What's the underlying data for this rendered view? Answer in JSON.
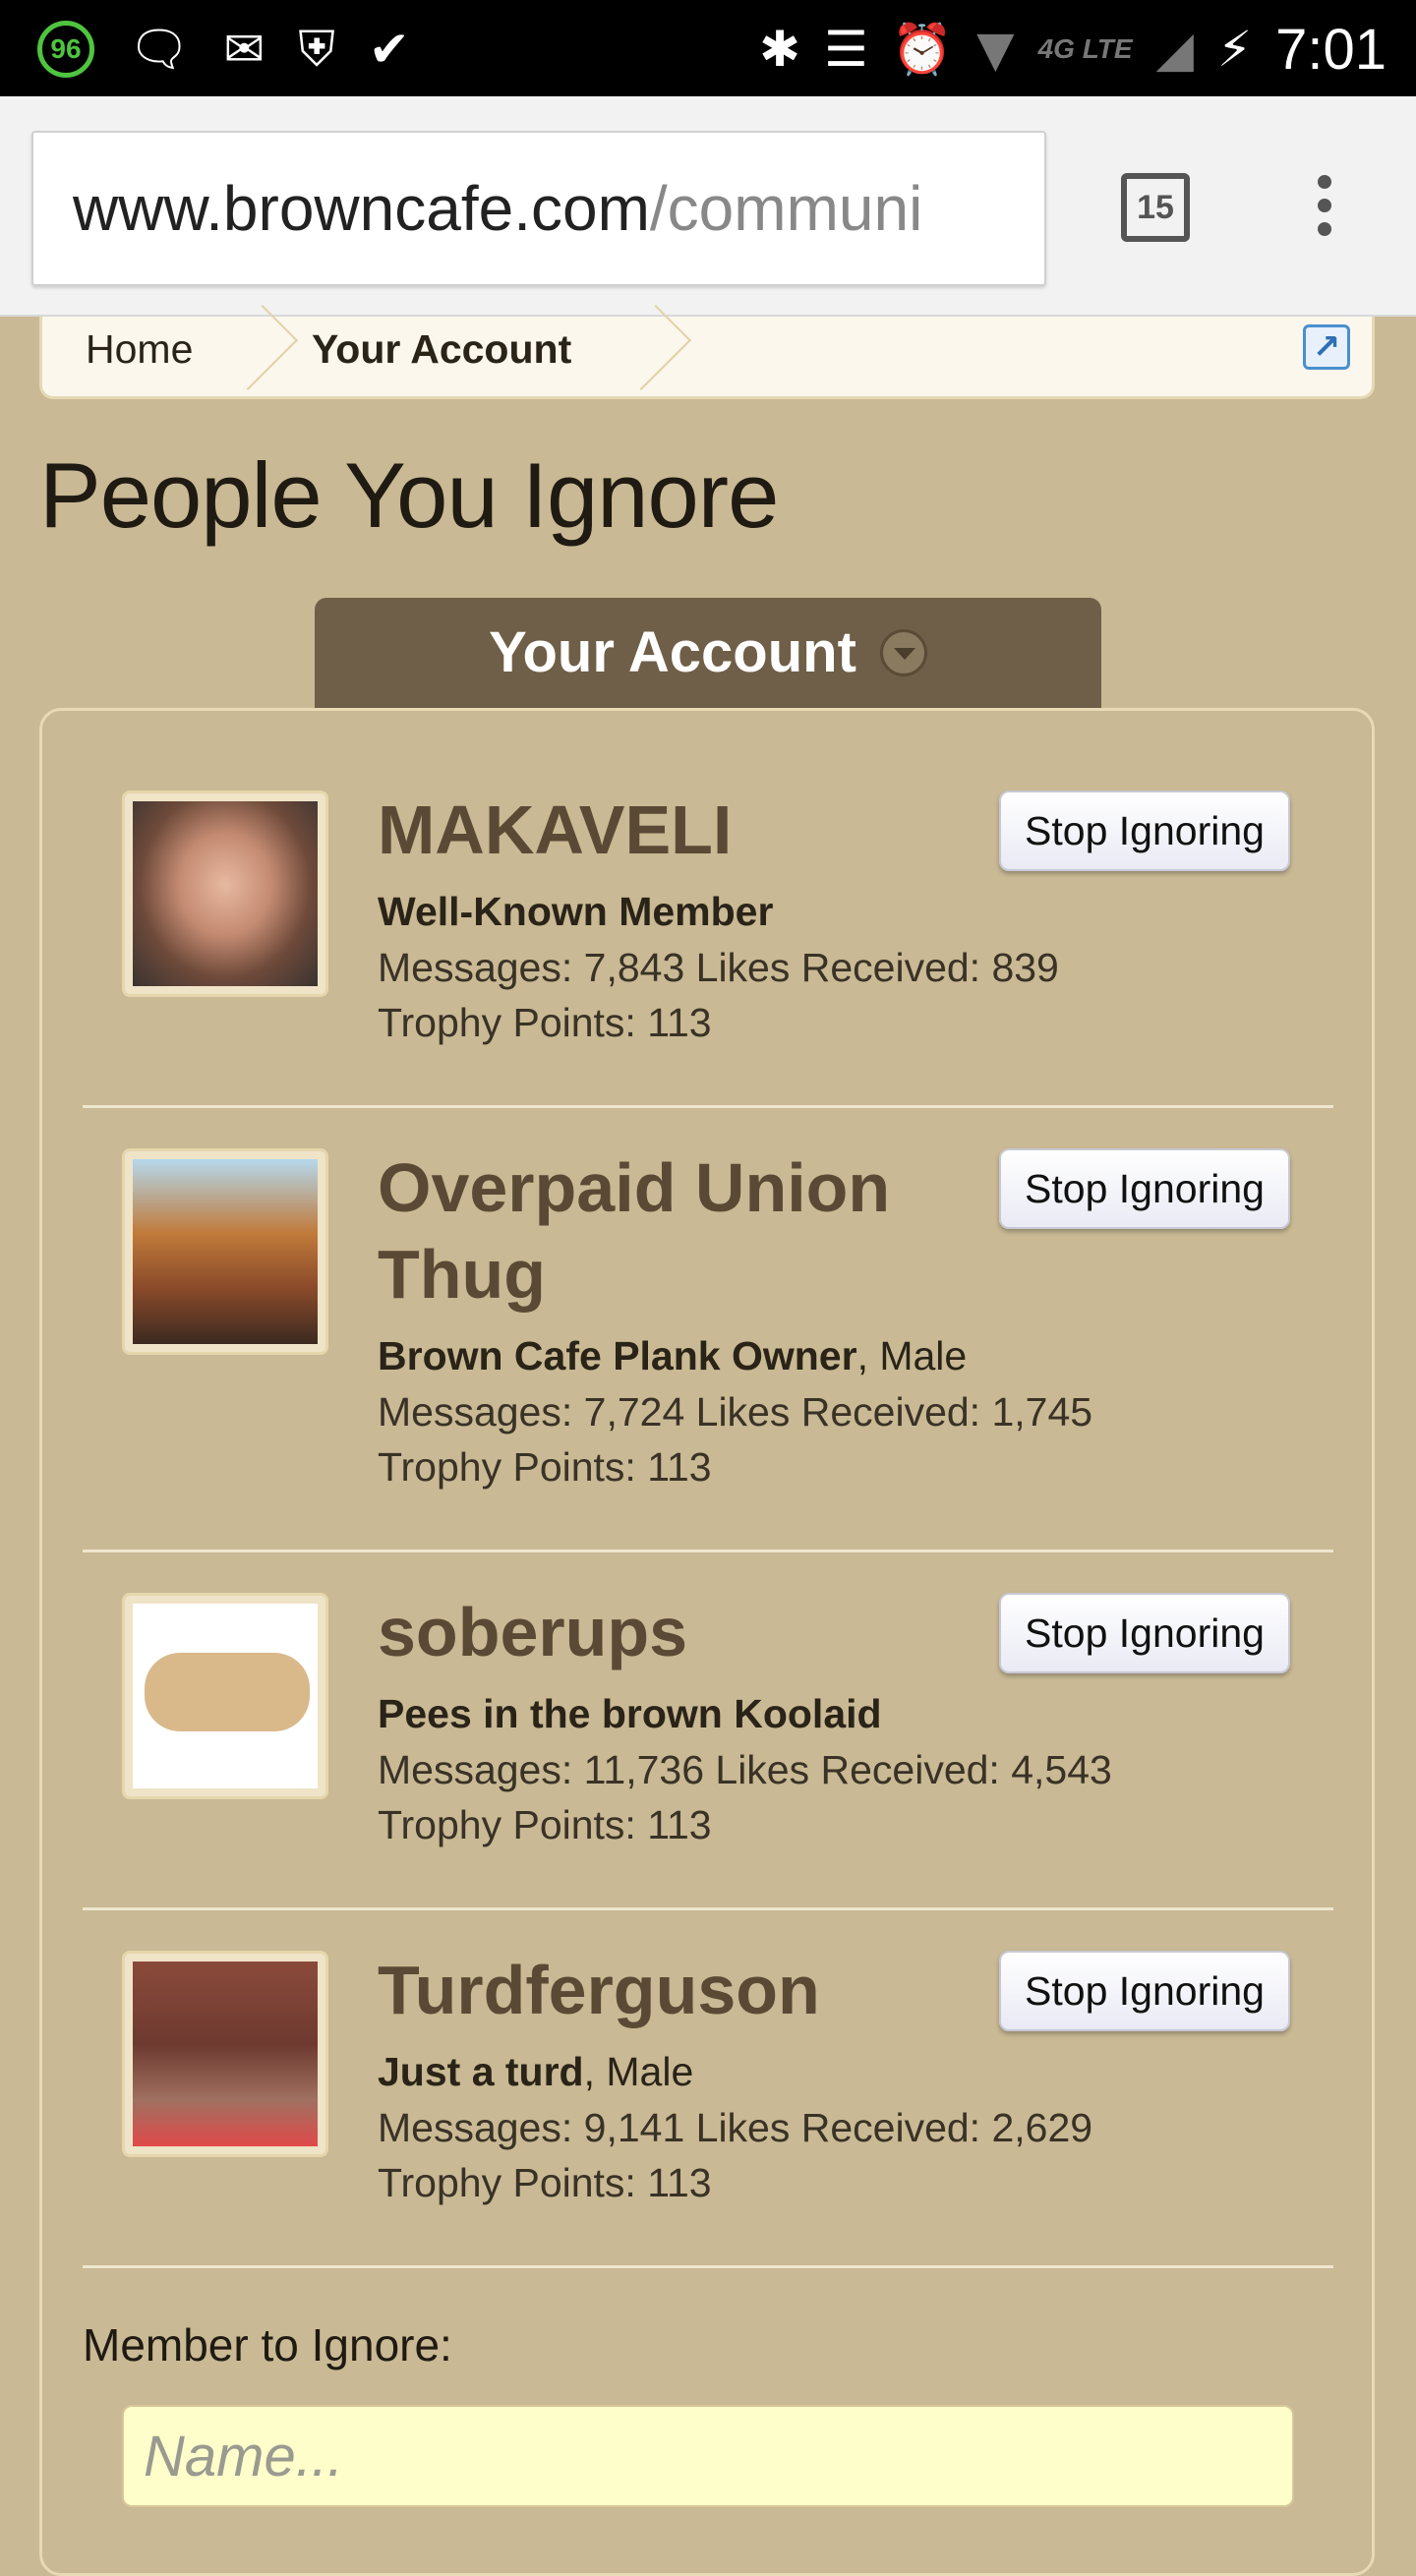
{
  "status_bar": {
    "battery_badge": "96",
    "network_label": "4G LTE",
    "time": "7:01"
  },
  "browser": {
    "url_host": "www.browncafe.com",
    "url_path": "/communi",
    "tab_count": "15"
  },
  "breadcrumb": {
    "items": [
      "Home",
      "Your Account"
    ]
  },
  "page": {
    "title": "People You Ignore",
    "menu_tab": "Your Account"
  },
  "members": [
    {
      "name": "MAKAVELI",
      "title": "Well-Known Member",
      "gender": "",
      "stats": "Messages: 7,843 Likes Received: 839",
      "trophy": "Trophy Points: 113",
      "button": "Stop Ignoring"
    },
    {
      "name": "Overpaid Union Thug",
      "title": "Brown Cafe Plank Owner",
      "gender": ", Male",
      "stats": "Messages: 7,724 Likes Received: 1,745",
      "trophy": "Trophy Points: 113",
      "button": "Stop Ignoring"
    },
    {
      "name": "soberups",
      "title": "Pees in the brown Koolaid",
      "gender": "",
      "stats": "Messages: 11,736 Likes Received: 4,543",
      "trophy": "Trophy Points: 113",
      "button": "Stop Ignoring"
    },
    {
      "name": "Turdferguson",
      "title": "Just a turd",
      "gender": ", Male",
      "stats": "Messages: 9,141 Likes Received: 2,629",
      "trophy": "Trophy Points: 113",
      "button": "Stop Ignoring"
    }
  ],
  "ignore_form": {
    "label": "Member to Ignore:",
    "placeholder": "Name..."
  }
}
